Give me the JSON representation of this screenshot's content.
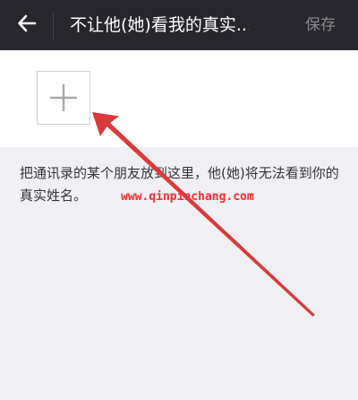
{
  "header": {
    "back_icon": "arrow-left-icon",
    "title": "不让他(她)看我的真实...",
    "save_label": "保存",
    "background": "#26262c",
    "save_color": "#8a8a90"
  },
  "add_member": {
    "icon": "plus-icon"
  },
  "hint": {
    "text": "把通讯录的某个朋友放到这里，他(她)将无法看到你的真实姓名。"
  },
  "watermark": {
    "text": "www.qinpinchang.com",
    "color": "#ff2a2a"
  },
  "annotation": {
    "icon": "red-arrow-icon",
    "color": "#d93a3a"
  }
}
